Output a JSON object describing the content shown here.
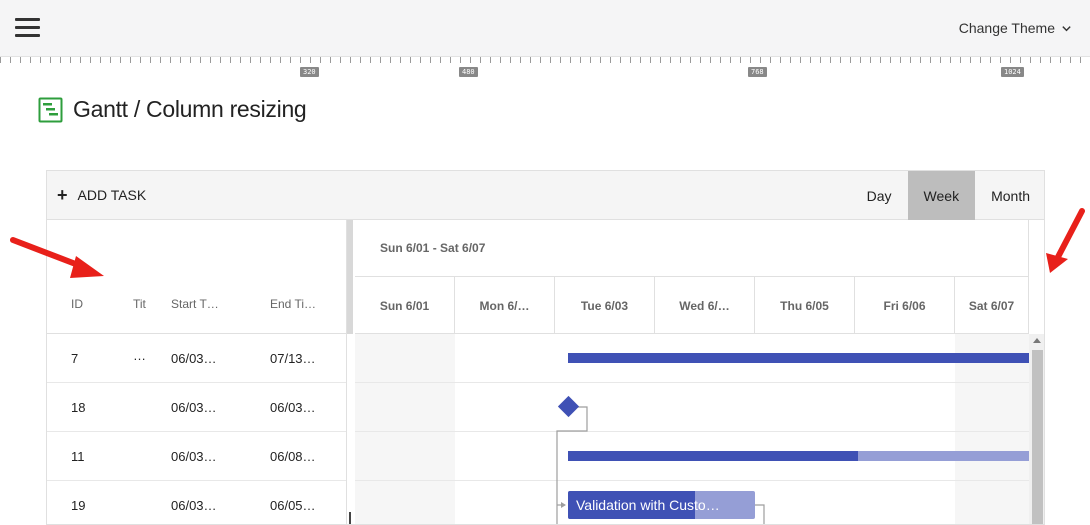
{
  "topbar": {
    "theme_label": "Change Theme"
  },
  "ruler": {
    "marks": [
      "320",
      "480",
      "768",
      "1024"
    ]
  },
  "page": {
    "title": "Gantt / Column resizing"
  },
  "toolbar": {
    "add_task_label": "ADD TASK",
    "views": [
      "Day",
      "Week",
      "Month"
    ],
    "active_view": "Week"
  },
  "grid": {
    "columns": [
      "ID",
      "Tit",
      "Start T…",
      "End Ti…"
    ],
    "rows": [
      {
        "id": "7",
        "title": "…",
        "start": "06/03…",
        "end": "07/13…"
      },
      {
        "id": "18",
        "title": "",
        "start": "06/03…",
        "end": "06/03…"
      },
      {
        "id": "11",
        "title": "",
        "start": "06/03…",
        "end": "06/08…"
      },
      {
        "id": "19",
        "title": "",
        "start": "06/03…",
        "end": "06/05…"
      }
    ]
  },
  "timeline": {
    "week_range": "Sun 6/01 - Sat 6/07",
    "days": [
      "Sun 6/01",
      "Mon 6/…",
      "Tue 6/03",
      "Wed 6/…",
      "Thu 6/05",
      "Fri 6/06",
      "Sat 6/07"
    ],
    "task_label": "Validation with Custo…"
  },
  "colors": {
    "bar": "#3f51b5",
    "bar_remaining": "#959ed6",
    "active_view_bg": "#bdbdbd",
    "annotation_arrow": "#e8201a",
    "logo": "#2e9e3c"
  }
}
